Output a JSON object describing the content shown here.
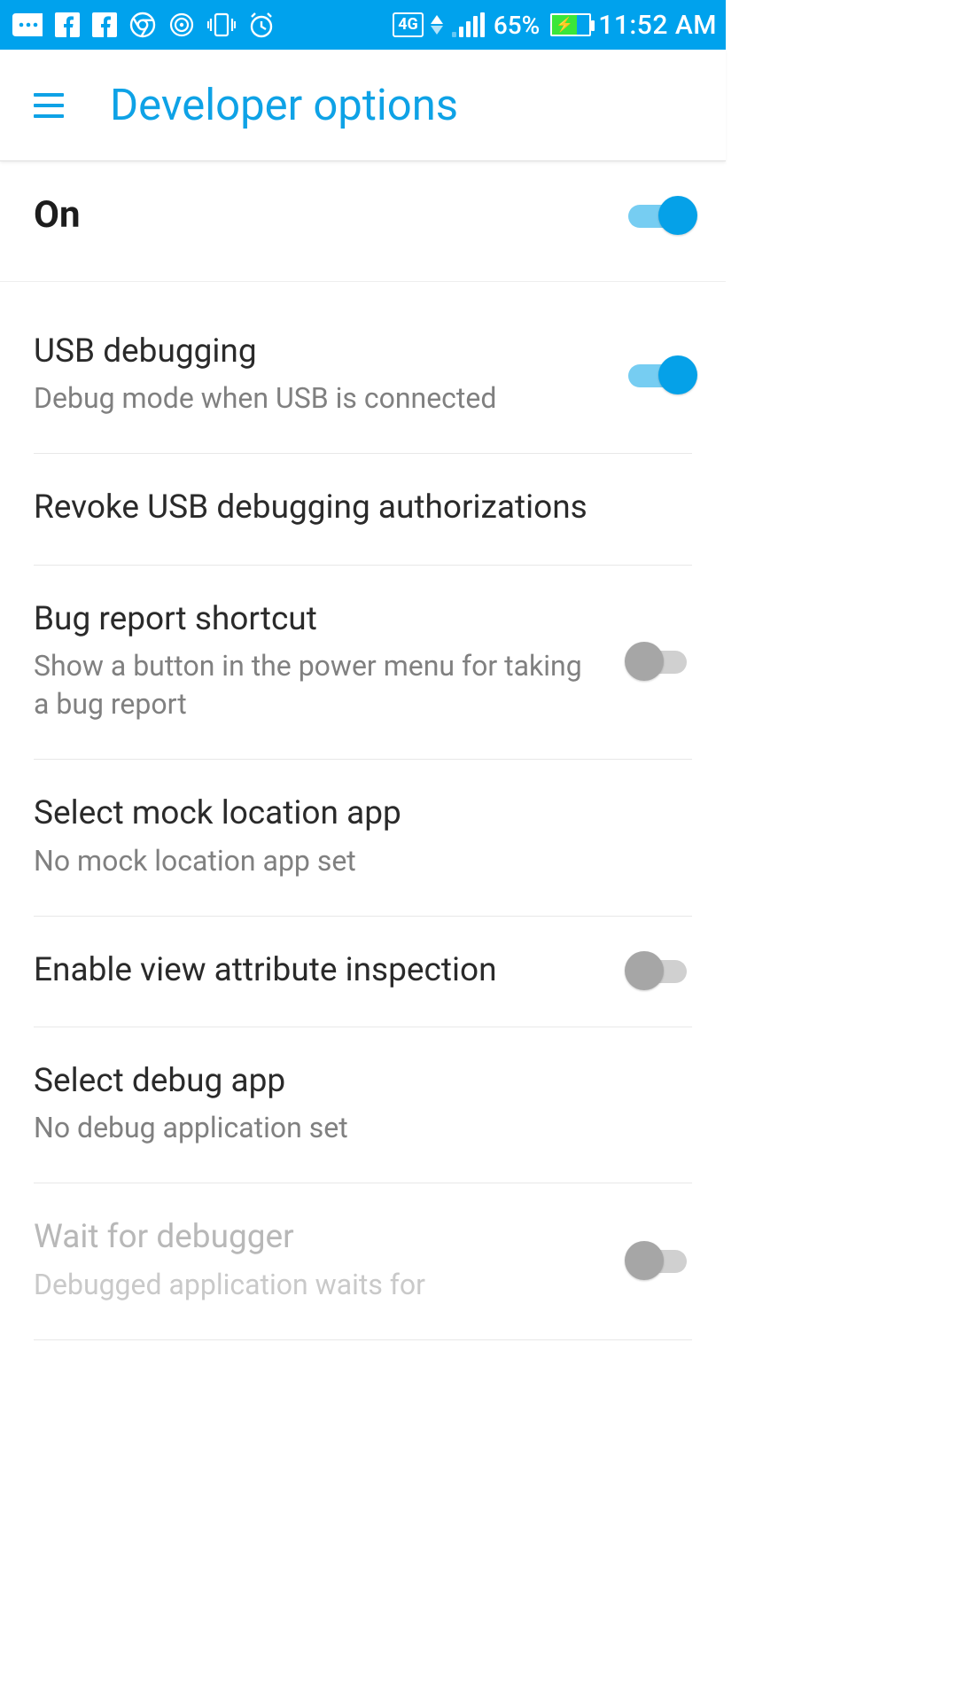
{
  "status_bar": {
    "network_label": "4G",
    "battery_percent": "65%",
    "time": "11:52 AM"
  },
  "app_bar": {
    "title": "Developer options"
  },
  "master": {
    "label": "On",
    "enabled": true
  },
  "items": [
    {
      "title": "USB debugging",
      "sub": "Debug mode when USB is connected",
      "has_switch": true,
      "switch_on": true,
      "disabled": false
    },
    {
      "title": "Revoke USB debugging authorizations",
      "sub": "",
      "has_switch": false,
      "switch_on": false,
      "disabled": false
    },
    {
      "title": "Bug report shortcut",
      "sub": "Show a button in the power menu for taking a bug report",
      "has_switch": true,
      "switch_on": false,
      "disabled": false
    },
    {
      "title": "Select mock location app",
      "sub": "No mock location app set",
      "has_switch": false,
      "switch_on": false,
      "disabled": false
    },
    {
      "title": "Enable view attribute inspection",
      "sub": "",
      "has_switch": true,
      "switch_on": false,
      "disabled": false
    },
    {
      "title": "Select debug app",
      "sub": "No debug application set",
      "has_switch": false,
      "switch_on": false,
      "disabled": false
    },
    {
      "title": "Wait for debugger",
      "sub": "Debugged application waits for",
      "has_switch": true,
      "switch_on": false,
      "disabled": true
    }
  ],
  "colors": {
    "accent": "#05a1e8",
    "status_bar_bg": "#00a2ed"
  }
}
